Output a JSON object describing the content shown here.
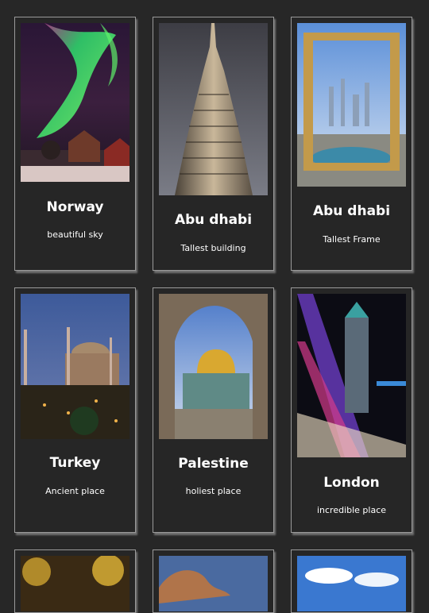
{
  "gallery": {
    "cards": [
      {
        "title": "Norway",
        "subtitle": "beautiful sky",
        "image": "northern-lights-cabin"
      },
      {
        "title": "Abu dhabi",
        "subtitle": "Tallest building",
        "image": "burj-khalifa-tower"
      },
      {
        "title": "Abu dhabi",
        "subtitle": "Tallest Frame",
        "image": "golden-frame-skyline"
      },
      {
        "title": "Turkey",
        "subtitle": "Ancient place",
        "image": "mosque-night-city"
      },
      {
        "title": "Palestine",
        "subtitle": "holiest place",
        "image": "golden-dome-arches"
      },
      {
        "title": "London",
        "subtitle": "incredible place",
        "image": "tower-bridge-light-trails"
      },
      {
        "title": "",
        "subtitle": "",
        "image": "golden-foliage"
      },
      {
        "title": "",
        "subtitle": "",
        "image": "desert-rock"
      },
      {
        "title": "",
        "subtitle": "",
        "image": "blue-sky-clouds"
      }
    ]
  }
}
